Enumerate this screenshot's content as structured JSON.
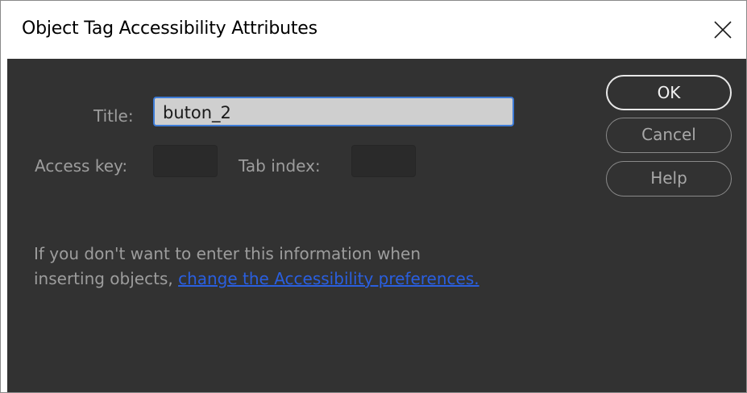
{
  "window": {
    "title": "Object Tag Accessibility Attributes",
    "close_icon": "close-x-icon"
  },
  "form": {
    "title_label": "Title:",
    "title_value": "buton_2",
    "access_key_label": "Access key:",
    "access_key_value": "",
    "tab_index_label": "Tab index:",
    "tab_index_value": ""
  },
  "buttons": {
    "ok": "OK",
    "cancel": "Cancel",
    "help": "Help"
  },
  "info": {
    "line1": "If you don't want to enter this information when",
    "line2_prefix": "inserting objects, ",
    "link_text": "change the Accessibility preferences."
  },
  "colors": {
    "dialog_background": "#323232",
    "focus_border": "#3d7bd6",
    "link": "#2a5fe0"
  }
}
